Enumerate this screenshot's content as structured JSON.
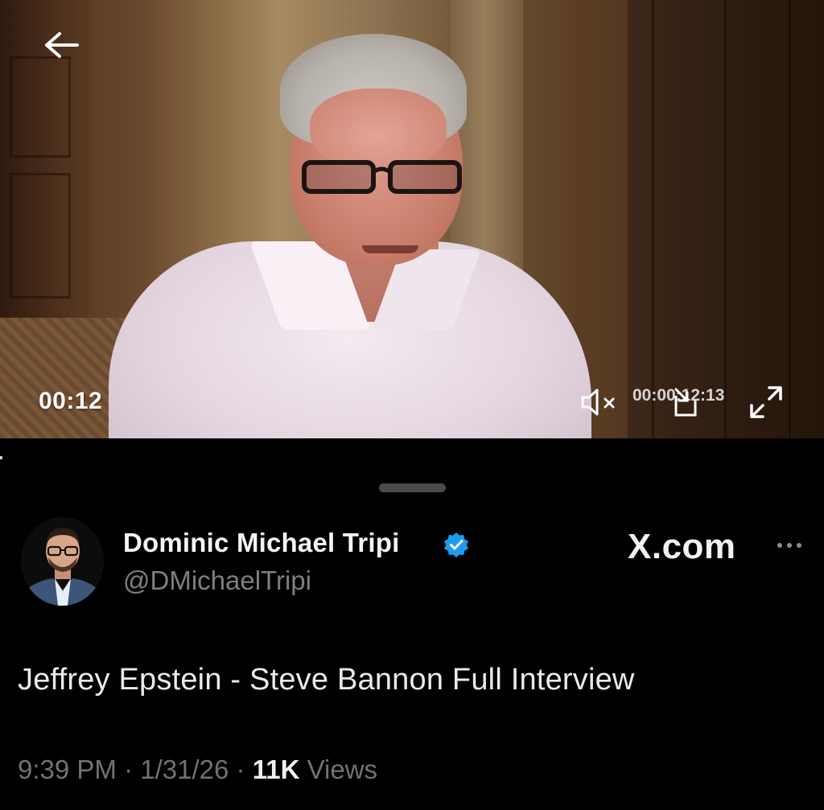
{
  "video": {
    "current_time": "00:12",
    "total_time": "00:00:12:13",
    "icons": {
      "back": "arrow-left-icon",
      "mute": "speaker-muted-icon",
      "pip": "picture-in-picture-icon",
      "fullscreen": "expand-icon"
    }
  },
  "post": {
    "author_name": "Dominic Michael Tripi",
    "author_handle": "@DMichaelTripi",
    "verified": true,
    "brand": "X.com",
    "text": "Jeffrey Epstein - Steve Bannon Full Interview",
    "time": "9:39 PM",
    "date": "1/31/26",
    "views_count": "11K",
    "views_label": "Views",
    "separator": "·"
  },
  "colors": {
    "background": "#000000",
    "verified_badge": "#1d9bf0",
    "muted_text": "#71767b"
  }
}
